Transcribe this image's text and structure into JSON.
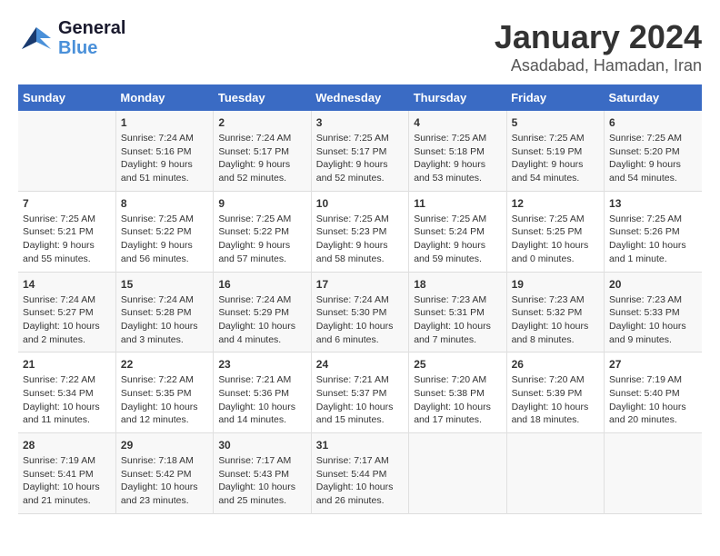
{
  "logo": {
    "line1": "General",
    "line2": "Blue"
  },
  "title": "January 2024",
  "subtitle": "Asadabad, Hamadan, Iran",
  "days_of_week": [
    "Sunday",
    "Monday",
    "Tuesday",
    "Wednesday",
    "Thursday",
    "Friday",
    "Saturday"
  ],
  "weeks": [
    [
      {
        "day": "",
        "text": ""
      },
      {
        "day": "1",
        "text": "Sunrise: 7:24 AM\nSunset: 5:16 PM\nDaylight: 9 hours\nand 51 minutes."
      },
      {
        "day": "2",
        "text": "Sunrise: 7:24 AM\nSunset: 5:17 PM\nDaylight: 9 hours\nand 52 minutes."
      },
      {
        "day": "3",
        "text": "Sunrise: 7:25 AM\nSunset: 5:17 PM\nDaylight: 9 hours\nand 52 minutes."
      },
      {
        "day": "4",
        "text": "Sunrise: 7:25 AM\nSunset: 5:18 PM\nDaylight: 9 hours\nand 53 minutes."
      },
      {
        "day": "5",
        "text": "Sunrise: 7:25 AM\nSunset: 5:19 PM\nDaylight: 9 hours\nand 54 minutes."
      },
      {
        "day": "6",
        "text": "Sunrise: 7:25 AM\nSunset: 5:20 PM\nDaylight: 9 hours\nand 54 minutes."
      }
    ],
    [
      {
        "day": "7",
        "text": "Sunrise: 7:25 AM\nSunset: 5:21 PM\nDaylight: 9 hours\nand 55 minutes."
      },
      {
        "day": "8",
        "text": "Sunrise: 7:25 AM\nSunset: 5:22 PM\nDaylight: 9 hours\nand 56 minutes."
      },
      {
        "day": "9",
        "text": "Sunrise: 7:25 AM\nSunset: 5:22 PM\nDaylight: 9 hours\nand 57 minutes."
      },
      {
        "day": "10",
        "text": "Sunrise: 7:25 AM\nSunset: 5:23 PM\nDaylight: 9 hours\nand 58 minutes."
      },
      {
        "day": "11",
        "text": "Sunrise: 7:25 AM\nSunset: 5:24 PM\nDaylight: 9 hours\nand 59 minutes."
      },
      {
        "day": "12",
        "text": "Sunrise: 7:25 AM\nSunset: 5:25 PM\nDaylight: 10 hours\nand 0 minutes."
      },
      {
        "day": "13",
        "text": "Sunrise: 7:25 AM\nSunset: 5:26 PM\nDaylight: 10 hours\nand 1 minute."
      }
    ],
    [
      {
        "day": "14",
        "text": "Sunrise: 7:24 AM\nSunset: 5:27 PM\nDaylight: 10 hours\nand 2 minutes."
      },
      {
        "day": "15",
        "text": "Sunrise: 7:24 AM\nSunset: 5:28 PM\nDaylight: 10 hours\nand 3 minutes."
      },
      {
        "day": "16",
        "text": "Sunrise: 7:24 AM\nSunset: 5:29 PM\nDaylight: 10 hours\nand 4 minutes."
      },
      {
        "day": "17",
        "text": "Sunrise: 7:24 AM\nSunset: 5:30 PM\nDaylight: 10 hours\nand 6 minutes."
      },
      {
        "day": "18",
        "text": "Sunrise: 7:23 AM\nSunset: 5:31 PM\nDaylight: 10 hours\nand 7 minutes."
      },
      {
        "day": "19",
        "text": "Sunrise: 7:23 AM\nSunset: 5:32 PM\nDaylight: 10 hours\nand 8 minutes."
      },
      {
        "day": "20",
        "text": "Sunrise: 7:23 AM\nSunset: 5:33 PM\nDaylight: 10 hours\nand 9 minutes."
      }
    ],
    [
      {
        "day": "21",
        "text": "Sunrise: 7:22 AM\nSunset: 5:34 PM\nDaylight: 10 hours\nand 11 minutes."
      },
      {
        "day": "22",
        "text": "Sunrise: 7:22 AM\nSunset: 5:35 PM\nDaylight: 10 hours\nand 12 minutes."
      },
      {
        "day": "23",
        "text": "Sunrise: 7:21 AM\nSunset: 5:36 PM\nDaylight: 10 hours\nand 14 minutes."
      },
      {
        "day": "24",
        "text": "Sunrise: 7:21 AM\nSunset: 5:37 PM\nDaylight: 10 hours\nand 15 minutes."
      },
      {
        "day": "25",
        "text": "Sunrise: 7:20 AM\nSunset: 5:38 PM\nDaylight: 10 hours\nand 17 minutes."
      },
      {
        "day": "26",
        "text": "Sunrise: 7:20 AM\nSunset: 5:39 PM\nDaylight: 10 hours\nand 18 minutes."
      },
      {
        "day": "27",
        "text": "Sunrise: 7:19 AM\nSunset: 5:40 PM\nDaylight: 10 hours\nand 20 minutes."
      }
    ],
    [
      {
        "day": "28",
        "text": "Sunrise: 7:19 AM\nSunset: 5:41 PM\nDaylight: 10 hours\nand 21 minutes."
      },
      {
        "day": "29",
        "text": "Sunrise: 7:18 AM\nSunset: 5:42 PM\nDaylight: 10 hours\nand 23 minutes."
      },
      {
        "day": "30",
        "text": "Sunrise: 7:17 AM\nSunset: 5:43 PM\nDaylight: 10 hours\nand 25 minutes."
      },
      {
        "day": "31",
        "text": "Sunrise: 7:17 AM\nSunset: 5:44 PM\nDaylight: 10 hours\nand 26 minutes."
      },
      {
        "day": "",
        "text": ""
      },
      {
        "day": "",
        "text": ""
      },
      {
        "day": "",
        "text": ""
      }
    ]
  ]
}
